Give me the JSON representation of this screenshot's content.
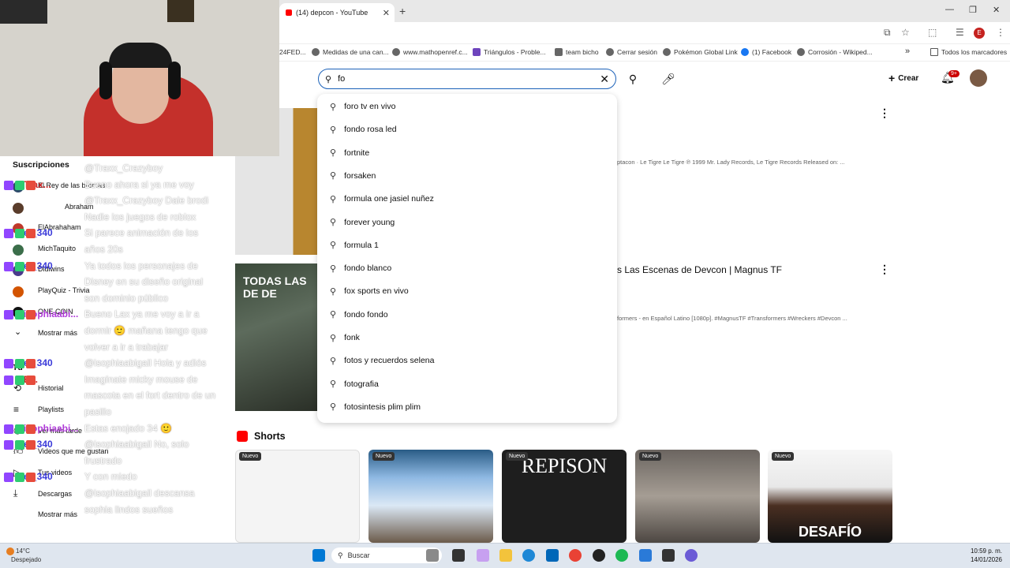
{
  "browser": {
    "tab_title": "(14) depcon - YouTube",
    "new_tab": "+",
    "bookmarks": [
      "24FED...",
      "Medidas de una can...",
      "www.mathopenref.c...",
      "Triángulos - Proble...",
      "team bicho",
      "Cerrar sesión",
      "Pokémon Global Link",
      "(1) Facebook",
      "Corrosión - Wikiped..."
    ],
    "more_bookmarks": "»",
    "all_bookmarks": "Todos los marcadores",
    "window_controls": [
      "—",
      "❐",
      "✕"
    ]
  },
  "header": {
    "search_value": "fo",
    "create_label": "Crear",
    "notif_badge": "9+"
  },
  "suggestions": [
    {
      "typed": "fo",
      "rest": "ro tv en vivo"
    },
    {
      "typed": "fo",
      "rest": "ndo rosa led"
    },
    {
      "typed": "fo",
      "rest": "rtnite"
    },
    {
      "typed": "fo",
      "rest": "rsaken"
    },
    {
      "typed": "fo",
      "rest": "rmula one jasiel nuñez"
    },
    {
      "typed": "fo",
      "rest": "rever young"
    },
    {
      "typed": "fo",
      "rest": "rmula 1"
    },
    {
      "typed": "fo",
      "rest": "ndo blanco"
    },
    {
      "typed": "fo",
      "rest": "x sports en vivo"
    },
    {
      "typed": "fo",
      "rest": "ndo fondo"
    },
    {
      "typed": "fo",
      "rest": "nk"
    },
    {
      "typed": "fo",
      "rest": "tos y recuerdos selena"
    },
    {
      "typed": "fo",
      "rest": "tografia"
    },
    {
      "typed": "fo",
      "rest": "tosintesis plim plim"
    }
  ],
  "results": {
    "video1_desc": "ptacon · Le Tigre Le Tigre ℗ 1999 Mr. Lady Records, Le Tigre Records Released on: ...",
    "video2_thumb_text": "TODAS LAS",
    "video2_thumb_text2": "DE DE",
    "video2_title": "s Las Escenas de Devcon | Magnus TF",
    "video2_desc": "formers - en Español Latino [1080p]. #MagnusTF #Transformers #Wreckers #Devcon ..."
  },
  "shorts": {
    "heading": "Shorts",
    "badge": "Nuevo",
    "items": [
      {
        "caption": ""
      },
      {
        "caption": ""
      },
      {
        "caption": "REPISON"
      },
      {
        "caption": ""
      },
      {
        "caption": "DESAFÍO"
      }
    ]
  },
  "sidebar": {
    "subscriptions": "Suscripciones",
    "items": [
      "El Rey de las bromas",
      "Abraham",
      "ElAbrahaham",
      "MichTaquito",
      "Didiwins",
      "PlayQuiz - Trivia",
      "ONE COIN",
      "Mostrar más"
    ],
    "you": "Tú",
    "you_items": [
      "Historial",
      "Playlists",
      "Ver más tarde",
      "Videos que me gustan",
      "Tus videos",
      "Descargas",
      "Mostrar más"
    ]
  },
  "chat": [
    {
      "name": "",
      "text": "@Traxx_Crazyboy"
    },
    {
      "name": "Trax...",
      "text": "Bueno ahora si ya me voy"
    },
    {
      "name": "",
      "text": "@Traxx_Crazyboy Dale brodi"
    },
    {
      "name": "",
      "text": "Nadie los juegos de roblox"
    },
    {
      "name": "el_340",
      "text": "Si parece animación de los"
    },
    {
      "name": "",
      "text": "años 20s"
    },
    {
      "name": "el_340",
      "text": "Ya todos los personajes de"
    },
    {
      "name": "",
      "text": "Disney en su diseño original"
    },
    {
      "name": "",
      "text": "son dominio público"
    },
    {
      "name": "isophiaabi...",
      "text": "Bueno Lax ya me voy a ir a"
    },
    {
      "name": "",
      "text": "dormir 🙂 mañana tengo que"
    },
    {
      "name": "",
      "text": "volver a ir a trabajar"
    },
    {
      "name": "el_340",
      "text": "@isophiaabigail Hola y adiós"
    },
    {
      "name": "E...",
      "text": "Imagínate micky mouse de"
    },
    {
      "name": "",
      "text": "mascota en el fort dentro de un"
    },
    {
      "name": "",
      "text": "pasillo"
    },
    {
      "name": "isophiaabi...",
      "text": "Estas enojado 34 🙂"
    },
    {
      "name": "el_340",
      "text": "@isophiaabigail No, solo"
    },
    {
      "name": "",
      "text": "frustrado"
    },
    {
      "name": "el_340",
      "text": "Y con miedo"
    },
    {
      "name": "",
      "text": "@isophiaabigail descansa"
    },
    {
      "name": "",
      "text": "sophia lindos sueños"
    }
  ],
  "taskbar": {
    "temp": "14°C",
    "weather": "Despejado",
    "search_placeholder": "Buscar",
    "time": "10:59 p. m.",
    "date": "14/01/2026"
  },
  "colors": {
    "accent": "#1c62b9",
    "brand": "#ff0000",
    "twitch": "#9146ff"
  }
}
